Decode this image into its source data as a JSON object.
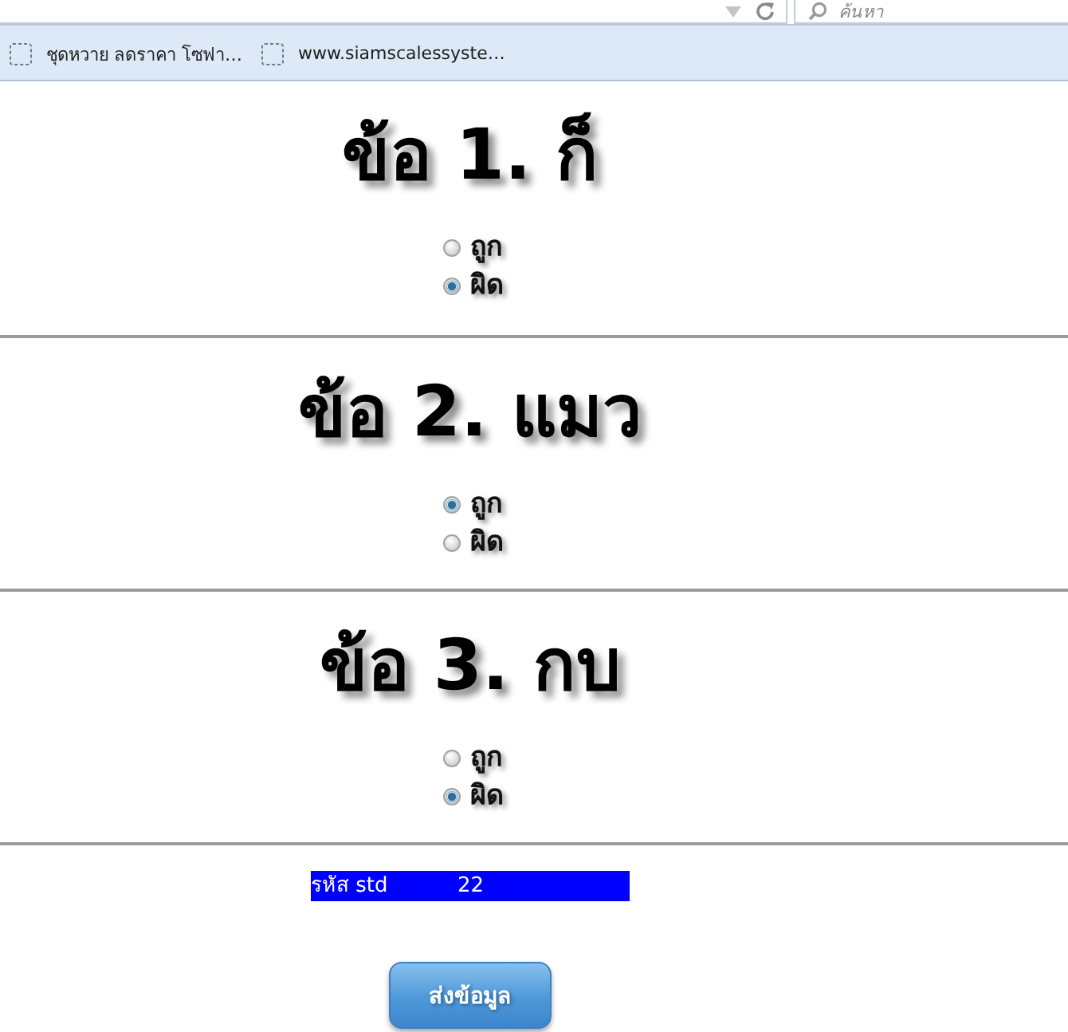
{
  "browser": {
    "search": {
      "placeholder": "ค้นหา"
    },
    "bookmarks": [
      {
        "label": "ชุดหวาย ลดราคา โซฟา…"
      },
      {
        "label": "www.siamscalessyste…"
      }
    ]
  },
  "questions": [
    {
      "title": "ข้อ 1. ก็",
      "options": [
        {
          "label": "ถูก",
          "selected": false
        },
        {
          "label": "ผิด",
          "selected": true
        }
      ]
    },
    {
      "title": "ข้อ 2. แมว",
      "options": [
        {
          "label": "ถูก",
          "selected": true
        },
        {
          "label": "ผิด",
          "selected": false
        }
      ]
    },
    {
      "title": "ข้อ 3. กบ",
      "options": [
        {
          "label": "ถูก",
          "selected": false
        },
        {
          "label": "ผิด",
          "selected": true
        }
      ]
    }
  ],
  "student_id": {
    "label": "รหัส std",
    "value": "22"
  },
  "submit_button": {
    "label": "ส่งข้อมูล"
  }
}
